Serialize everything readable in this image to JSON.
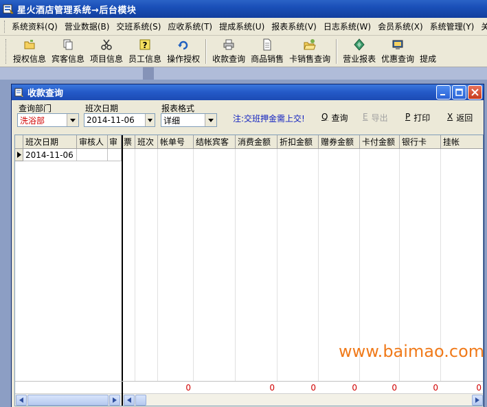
{
  "app": {
    "title": "星火酒店管理系统→后台模块"
  },
  "menu": [
    "系统资料(Q)",
    "营业数据(B)",
    "交班系统(S)",
    "应收系统(T)",
    "提成系统(U)",
    "报表系统(V)",
    "日志系统(W)",
    "会员系统(X)",
    "系统管理(Y)",
    "关于"
  ],
  "toolbar": {
    "items": [
      {
        "label": "授权信息",
        "icon": "folder-icon"
      },
      {
        "label": "宾客信息",
        "icon": "copy-icon"
      },
      {
        "label": "项目信息",
        "icon": "scissors-icon"
      },
      {
        "label": "员工信息",
        "icon": "help-icon"
      },
      {
        "label": "操作授权",
        "icon": "refresh-icon"
      },
      {
        "label": "收款查询",
        "icon": "printer-icon"
      },
      {
        "label": "商品销售",
        "icon": "document-icon"
      },
      {
        "label": "卡销售查询",
        "icon": "folder-open-icon"
      },
      {
        "label": "营业报表",
        "icon": "diamond-icon"
      },
      {
        "label": "优惠查询",
        "icon": "monitor-icon"
      },
      {
        "label": "提成"
      }
    ]
  },
  "window": {
    "title": "收款查询",
    "query": {
      "dept_label": "查询部门",
      "dept_value": "洗浴部",
      "date_label": "班次日期",
      "date_value": "2014-11-06",
      "format_label": "报表格式",
      "format_value": "详细",
      "note": "注:交班押金需上交!",
      "search": {
        "hotkey": "Q",
        "label": "查询"
      },
      "export": {
        "hotkey": "E",
        "label": "导出"
      },
      "print": {
        "hotkey": "P",
        "label": "打印"
      },
      "back": {
        "hotkey": "X",
        "label": "返回"
      }
    },
    "grid": {
      "columns": [
        "班次日期",
        "审核人",
        "审",
        "票",
        "班次",
        "帐单号",
        "结帐宾客",
        "消费金额",
        "折扣金额",
        "赠券金额",
        "卡付金额",
        "银行卡",
        "挂帐"
      ],
      "rows": [
        [
          "2014-11-06"
        ]
      ],
      "totals": [
        "0",
        "0",
        "0",
        "0",
        "0",
        "0",
        "0"
      ]
    }
  },
  "watermark": "www.baimao.com",
  "colors": {
    "title_blue": "#1a4fb8",
    "note_blue": "#1020c0",
    "total_red": "#d00000",
    "watermark_orange": "#f07a1a"
  }
}
